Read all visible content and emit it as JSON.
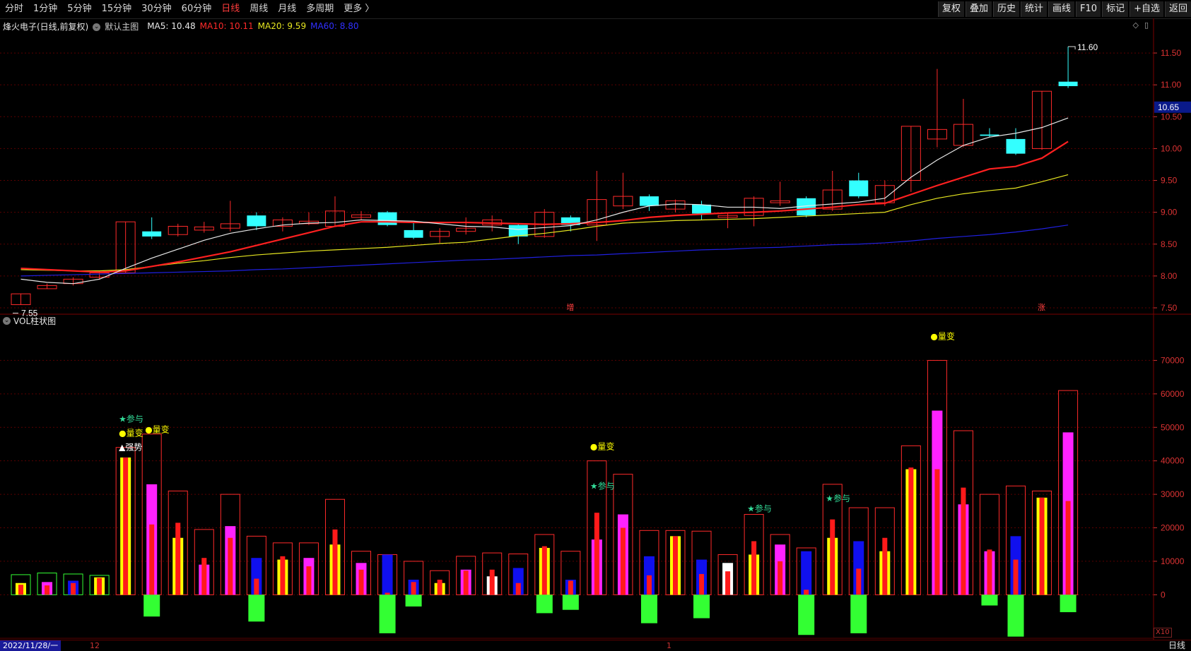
{
  "toolbar": {
    "periods": [
      {
        "label": "分时"
      },
      {
        "label": "1分钟"
      },
      {
        "label": "5分钟"
      },
      {
        "label": "15分钟"
      },
      {
        "label": "30分钟"
      },
      {
        "label": "60分钟"
      },
      {
        "label": "日线",
        "active": true
      },
      {
        "label": "周线"
      },
      {
        "label": "月线"
      },
      {
        "label": "多周期"
      },
      {
        "label": "更多 〉"
      }
    ],
    "tools": [
      {
        "label": "复权"
      },
      {
        "label": "叠加"
      },
      {
        "label": "历史"
      },
      {
        "label": "统计"
      },
      {
        "label": "画线"
      },
      {
        "label": "F10"
      },
      {
        "label": "标记"
      },
      {
        "label": "+自选"
      },
      {
        "label": "返回"
      }
    ]
  },
  "info": {
    "title": "烽火电子(日线,前复权)",
    "template": "默认主图",
    "ma5": "MA5: 10.48",
    "ma10": "MA10: 10.11",
    "ma20": "MA20: 9.59",
    "ma60": "MA60: 8.80"
  },
  "volume_panel": {
    "title": "VOL柱状图",
    "scale": "X10"
  },
  "bottom": {
    "date": "2022/11/28/一",
    "tick_12": "12",
    "tick_1": "1",
    "period": "日线"
  },
  "colors": {
    "up": "#ff2a2a",
    "down": "#33ffff",
    "ma5": "#e8e8e8",
    "ma10": "#ff2020",
    "ma20": "#e6e620",
    "ma60": "#2020e0",
    "vol_green": "#33ff33",
    "vol_magenta": "#ff22ff",
    "vol_blue": "#1010ee",
    "vol_yellow": "#ffff00"
  },
  "chart_data": [
    {
      "type": "candlestick",
      "ylim": [
        7.4,
        11.8
      ],
      "yticks": [
        "7.50",
        "8.00",
        "8.50",
        "9.00",
        "9.50",
        "10.00",
        "10.50",
        "11.00",
        "11.50"
      ],
      "current_price": "10.65",
      "high_label": "11.60",
      "low_label": "7.55",
      "markers": [
        "增",
        "涨"
      ],
      "candles": [
        {
          "o": 7.55,
          "c": 7.72,
          "h": 7.72,
          "l": 7.55
        },
        {
          "o": 7.8,
          "c": 7.85,
          "h": 7.88,
          "l": 7.8
        },
        {
          "o": 7.88,
          "c": 7.95,
          "h": 7.98,
          "l": 7.85
        },
        {
          "o": 7.98,
          "c": 8.05,
          "h": 8.08,
          "l": 7.95
        },
        {
          "o": 8.05,
          "c": 8.85,
          "h": 8.85,
          "l": 8.05
        },
        {
          "o": 8.7,
          "c": 8.62,
          "h": 8.92,
          "l": 8.58
        },
        {
          "o": 8.65,
          "c": 8.78,
          "h": 8.82,
          "l": 8.62
        },
        {
          "o": 8.72,
          "c": 8.77,
          "h": 8.85,
          "l": 8.68
        },
        {
          "o": 8.75,
          "c": 8.82,
          "h": 9.18,
          "l": 8.7
        },
        {
          "o": 8.95,
          "c": 8.78,
          "h": 9.0,
          "l": 8.72
        },
        {
          "o": 8.78,
          "c": 8.88,
          "h": 8.92,
          "l": 8.7
        },
        {
          "o": 8.82,
          "c": 8.86,
          "h": 9.0,
          "l": 8.8
        },
        {
          "o": 8.78,
          "c": 9.02,
          "h": 9.25,
          "l": 8.78
        },
        {
          "o": 8.92,
          "c": 8.96,
          "h": 9.02,
          "l": 8.88
        },
        {
          "o": 9.0,
          "c": 8.8,
          "h": 9.02,
          "l": 8.78
        },
        {
          "o": 8.72,
          "c": 8.6,
          "h": 8.85,
          "l": 8.58
        },
        {
          "o": 8.62,
          "c": 8.7,
          "h": 8.75,
          "l": 8.52
        },
        {
          "o": 8.7,
          "c": 8.75,
          "h": 8.92,
          "l": 8.65
        },
        {
          "o": 8.8,
          "c": 8.88,
          "h": 8.95,
          "l": 8.7
        },
        {
          "o": 8.8,
          "c": 8.62,
          "h": 8.82,
          "l": 8.5
        },
        {
          "o": 8.62,
          "c": 9.0,
          "h": 9.05,
          "l": 8.6
        },
        {
          "o": 8.92,
          "c": 8.8,
          "h": 8.95,
          "l": 8.7
        },
        {
          "o": 8.8,
          "c": 9.2,
          "h": 9.65,
          "l": 8.55
        },
        {
          "o": 9.1,
          "c": 9.25,
          "h": 9.62,
          "l": 9.05
        },
        {
          "o": 9.25,
          "c": 9.1,
          "h": 9.28,
          "l": 9.02
        },
        {
          "o": 9.05,
          "c": 9.18,
          "h": 9.2,
          "l": 9.0
        },
        {
          "o": 9.12,
          "c": 8.98,
          "h": 9.18,
          "l": 8.88
        },
        {
          "o": 8.92,
          "c": 8.95,
          "h": 8.98,
          "l": 8.75
        },
        {
          "o": 8.95,
          "c": 9.22,
          "h": 9.25,
          "l": 8.78
        },
        {
          "o": 9.15,
          "c": 9.18,
          "h": 9.48,
          "l": 9.1
        },
        {
          "o": 9.22,
          "c": 8.95,
          "h": 9.25,
          "l": 8.92
        },
        {
          "o": 9.05,
          "c": 9.35,
          "h": 9.65,
          "l": 9.02
        },
        {
          "o": 9.5,
          "c": 9.25,
          "h": 9.62,
          "l": 9.22
        },
        {
          "o": 9.15,
          "c": 9.42,
          "h": 9.5,
          "l": 9.1
        },
        {
          "o": 9.5,
          "c": 10.35,
          "h": 10.35,
          "l": 9.32
        },
        {
          "o": 10.15,
          "c": 10.3,
          "h": 11.25,
          "l": 10.02
        },
        {
          "o": 10.05,
          "c": 10.38,
          "h": 10.78,
          "l": 10.02
        },
        {
          "o": 10.22,
          "c": 10.2,
          "h": 10.32,
          "l": 10.18
        },
        {
          "o": 10.15,
          "c": 9.92,
          "h": 10.32,
          "l": 9.9
        },
        {
          "o": 10.0,
          "c": 10.9,
          "h": 10.9,
          "l": 9.98
        },
        {
          "o": 11.05,
          "c": 10.98,
          "h": 11.6,
          "l": 10.95
        }
      ],
      "ma5": [
        7.95,
        7.9,
        7.88,
        7.95,
        8.12,
        8.28,
        8.42,
        8.56,
        8.67,
        8.74,
        8.8,
        8.83,
        8.84,
        8.88,
        8.87,
        8.86,
        8.82,
        8.78,
        8.77,
        8.73,
        8.76,
        8.79,
        8.88,
        9.0,
        9.1,
        9.13,
        9.12,
        9.08,
        9.08,
        9.06,
        9.1,
        9.13,
        9.16,
        9.22,
        9.55,
        9.82,
        10.05,
        10.18,
        10.24,
        10.33,
        10.48
      ],
      "ma10": [
        8.12,
        8.1,
        8.08,
        8.06,
        8.08,
        8.15,
        8.22,
        8.3,
        8.38,
        8.48,
        8.58,
        8.68,
        8.78,
        8.85,
        8.85,
        8.84,
        8.84,
        8.84,
        8.83,
        8.82,
        8.81,
        8.82,
        8.84,
        8.87,
        8.92,
        8.95,
        8.97,
        8.99,
        9.0,
        9.02,
        9.05,
        9.08,
        9.12,
        9.14,
        9.28,
        9.42,
        9.55,
        9.68,
        9.72,
        9.85,
        10.11
      ],
      "ma20": [
        8.1,
        8.09,
        8.08,
        8.08,
        8.1,
        8.15,
        8.2,
        8.24,
        8.29,
        8.33,
        8.36,
        8.39,
        8.41,
        8.43,
        8.45,
        8.48,
        8.51,
        8.53,
        8.58,
        8.63,
        8.67,
        8.72,
        8.78,
        8.83,
        8.85,
        8.87,
        8.88,
        8.89,
        8.9,
        8.92,
        8.94,
        8.96,
        8.98,
        9.0,
        9.12,
        9.22,
        9.29,
        9.34,
        9.38,
        9.48,
        9.59
      ],
      "ma60": [
        8.0,
        8.01,
        8.02,
        8.03,
        8.04,
        8.05,
        8.06,
        8.07,
        8.08,
        8.1,
        8.11,
        8.13,
        8.15,
        8.17,
        8.19,
        8.21,
        8.23,
        8.25,
        8.26,
        8.28,
        8.3,
        8.32,
        8.33,
        8.35,
        8.37,
        8.39,
        8.41,
        8.42,
        8.44,
        8.45,
        8.47,
        8.49,
        8.5,
        8.52,
        8.55,
        8.59,
        8.62,
        8.65,
        8.69,
        8.74,
        8.8
      ]
    },
    {
      "type": "bar",
      "ylim": [
        -13000,
        80000
      ],
      "yticks": [
        "0",
        "10000",
        "20000",
        "30000",
        "40000",
        "50000",
        "60000",
        "70000"
      ],
      "volumes": [
        6000,
        6500,
        6200,
        5800,
        44000,
        48000,
        31000,
        19500,
        30000,
        17500,
        15500,
        15500,
        28500,
        13000,
        12000,
        10000,
        7200,
        11500,
        12500,
        12200,
        18000,
        13000,
        40000,
        36000,
        19200,
        19200,
        19000,
        12000,
        24000,
        18000,
        14000,
        33000,
        26000,
        26000,
        44500,
        70000,
        49000,
        30000,
        32500,
        31000,
        61000
      ],
      "outline": [
        "g",
        "g",
        "g",
        "g",
        "r",
        "r",
        "r",
        "r",
        "r",
        "r",
        "r",
        "r",
        "r",
        "r",
        "r",
        "r",
        "r",
        "r",
        "r",
        "r",
        "r",
        "r",
        "r",
        "r",
        "r",
        "r",
        "r",
        "r",
        "r",
        "r",
        "r",
        "r",
        "r",
        "r",
        "r",
        "r",
        "r",
        "r",
        "r",
        "r",
        "r"
      ],
      "wide": [
        3500,
        3800,
        4200,
        5200,
        41000,
        33000,
        17000,
        9000,
        20500,
        11000,
        10500,
        11000,
        15000,
        9500,
        12000,
        4500,
        3500,
        7500,
        5500,
        8000,
        14000,
        4500,
        16500,
        24000,
        11500,
        17500,
        10500,
        9500,
        12000,
        15000,
        13000,
        17000,
        16000,
        13000,
        37500,
        55000,
        27000,
        13000,
        17500,
        29000,
        48500
      ],
      "wide_color": [
        "y",
        "m",
        "b",
        "y",
        "y",
        "m",
        "y",
        "m",
        "m",
        "b",
        "y",
        "m",
        "y",
        "m",
        "b",
        "b",
        "y",
        "m",
        "w",
        "b",
        "y",
        "b",
        "m",
        "m",
        "b",
        "y",
        "b",
        "w",
        "y",
        "m",
        "b",
        "y",
        "b",
        "y",
        "y",
        "m",
        "m",
        "m",
        "b",
        "y",
        "m"
      ],
      "narrow": [
        3000,
        2800,
        3500,
        5000,
        41000,
        21000,
        21500,
        11000,
        17000,
        4800,
        11500,
        8500,
        19500,
        7500,
        600,
        3800,
        4500,
        7200,
        7500,
        3500,
        14500,
        4200,
        24500,
        20000,
        5800,
        17500,
        6200,
        7000,
        16000,
        10000,
        1500,
        22500,
        7800,
        17000,
        38000,
        37500,
        32000,
        13500,
        10500,
        29000,
        28000
      ],
      "neg": [
        0,
        0,
        0,
        0,
        0,
        -6500,
        0,
        0,
        0,
        -8000,
        0,
        0,
        0,
        0,
        -11500,
        -3500,
        0,
        0,
        0,
        0,
        -5500,
        -4500,
        0,
        0,
        -8500,
        0,
        -7000,
        0,
        0,
        0,
        -12000,
        0,
        -11500,
        0,
        0,
        0,
        0,
        -3200,
        -12500,
        0,
        -5200
      ],
      "annotations": [
        {
          "bar": 4,
          "dy": -36,
          "text": "★参与",
          "color": "#33dd99"
        },
        {
          "bar": 4,
          "dy": -16,
          "text": "●量变",
          "color": "#ffff00"
        },
        {
          "bar": 4,
          "dy": 4,
          "text": "▲强势",
          "color": "#ffffff"
        },
        {
          "bar": 5,
          "dy": -2,
          "text": "●量变",
          "color": "#ffff00"
        },
        {
          "bar": 22,
          "dy": -16,
          "text": "●量变",
          "color": "#ffff00"
        },
        {
          "bar": 22,
          "dy": 40,
          "text": "★参与",
          "color": "#33dd99"
        },
        {
          "bar": 28,
          "dy": -4,
          "text": "★参与",
          "color": "#33dd99"
        },
        {
          "bar": 31,
          "dy": 24,
          "text": "★参与",
          "color": "#33dd99"
        },
        {
          "bar": 35,
          "dy": -30,
          "text": "●量变",
          "color": "#ffff00"
        }
      ]
    }
  ]
}
